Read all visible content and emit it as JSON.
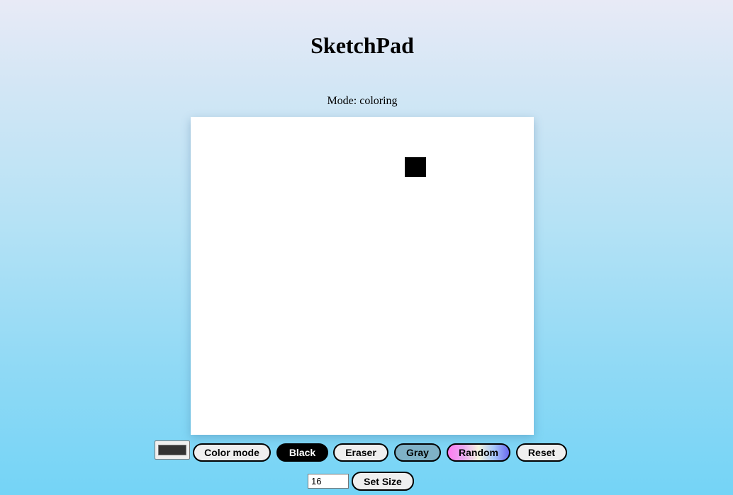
{
  "app": {
    "title": "SketchPad",
    "mode_text": "Mode: coloring"
  },
  "grid": {
    "size": 16,
    "filled_cells": [
      {
        "row": 2,
        "col": 10,
        "color": "#000000"
      }
    ],
    "background_color": "#ffffff"
  },
  "controls": {
    "color_picker": {
      "value": "#333333"
    },
    "buttons": {
      "color_mode": "Color mode",
      "black": "Black",
      "eraser": "Eraser",
      "gray": "Gray",
      "random": "Random",
      "reset": "Reset"
    }
  },
  "size_control": {
    "value": "16",
    "button_label": "Set Size"
  },
  "colors": {
    "black_button": "#000000",
    "gray_button": "#7fb1c6",
    "default_button": "#efefef"
  }
}
